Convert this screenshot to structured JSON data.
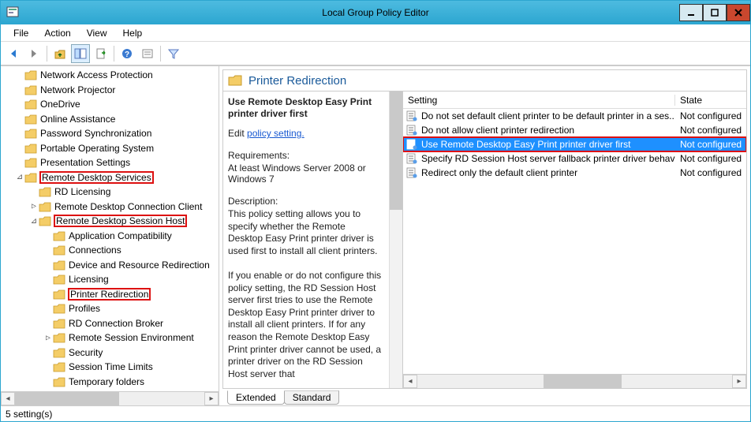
{
  "window": {
    "title": "Local Group Policy Editor"
  },
  "menu": {
    "file": "File",
    "action": "Action",
    "view": "View",
    "help": "Help"
  },
  "toolbar": {
    "back": "back",
    "forward": "forward",
    "up": "up-folder",
    "show_hide": "show-hide-tree",
    "export": "export-list",
    "help": "help",
    "props": "properties",
    "filter": "filter"
  },
  "tree": {
    "items": [
      {
        "indent": 1,
        "exp": "",
        "label": "Network Access Protection",
        "hl": false
      },
      {
        "indent": 1,
        "exp": "",
        "label": "Network Projector",
        "hl": false
      },
      {
        "indent": 1,
        "exp": "",
        "label": "OneDrive",
        "hl": false
      },
      {
        "indent": 1,
        "exp": "",
        "label": "Online Assistance",
        "hl": false
      },
      {
        "indent": 1,
        "exp": "",
        "label": "Password Synchronization",
        "hl": false
      },
      {
        "indent": 1,
        "exp": "",
        "label": "Portable Operating System",
        "hl": false
      },
      {
        "indent": 1,
        "exp": "",
        "label": "Presentation Settings",
        "hl": false
      },
      {
        "indent": 1,
        "exp": "⊿",
        "label": "Remote Desktop Services",
        "hl": true
      },
      {
        "indent": 2,
        "exp": "",
        "label": "RD Licensing",
        "hl": false
      },
      {
        "indent": 2,
        "exp": "▷",
        "label": "Remote Desktop Connection Client",
        "hl": false
      },
      {
        "indent": 2,
        "exp": "⊿",
        "label": "Remote Desktop Session Host",
        "hl": true
      },
      {
        "indent": 3,
        "exp": "",
        "label": "Application Compatibility",
        "hl": false
      },
      {
        "indent": 3,
        "exp": "",
        "label": "Connections",
        "hl": false
      },
      {
        "indent": 3,
        "exp": "",
        "label": "Device and Resource Redirection",
        "hl": false
      },
      {
        "indent": 3,
        "exp": "",
        "label": "Licensing",
        "hl": false
      },
      {
        "indent": 3,
        "exp": "",
        "label": "Printer Redirection",
        "hl": true
      },
      {
        "indent": 3,
        "exp": "",
        "label": "Profiles",
        "hl": false
      },
      {
        "indent": 3,
        "exp": "",
        "label": "RD Connection Broker",
        "hl": false
      },
      {
        "indent": 3,
        "exp": "▷",
        "label": "Remote Session Environment",
        "hl": false
      },
      {
        "indent": 3,
        "exp": "",
        "label": "Security",
        "hl": false
      },
      {
        "indent": 3,
        "exp": "",
        "label": "Session Time Limits",
        "hl": false
      },
      {
        "indent": 3,
        "exp": "",
        "label": "Temporary folders",
        "hl": false
      }
    ]
  },
  "details": {
    "header": "Printer Redirection",
    "policy_name": "Use Remote Desktop Easy Print printer driver first",
    "edit_label": "Edit",
    "edit_link": "policy setting.",
    "requirements_label": "Requirements:",
    "requirements_text": "At least Windows Server 2008 or Windows 7",
    "description_label": "Description:",
    "description_body": "This policy setting allows you to specify whether the Remote Desktop Easy Print printer driver is used first to install all client printers.\n\nIf you enable or do not configure this policy setting, the RD Session Host server first tries to use the Remote Desktop Easy Print printer driver to install all client printers. If for any reason the Remote Desktop Easy Print printer driver cannot be used, a printer driver on the RD Session Host server that"
  },
  "settings": {
    "col_setting": "Setting",
    "col_state": "State",
    "rows": [
      {
        "name": "Do not set default client printer to be default printer in a ses...",
        "state": "Not configured",
        "selected": false,
        "hl": false
      },
      {
        "name": "Do not allow client printer redirection",
        "state": "Not configured",
        "selected": false,
        "hl": false
      },
      {
        "name": "Use Remote Desktop Easy Print printer driver first",
        "state": "Not configured",
        "selected": true,
        "hl": true
      },
      {
        "name": "Specify RD Session Host server fallback printer driver behavior",
        "state": "Not configured",
        "selected": false,
        "hl": false
      },
      {
        "name": "Redirect only the default client printer",
        "state": "Not configured",
        "selected": false,
        "hl": false
      }
    ]
  },
  "tabs": {
    "extended": "Extended",
    "standard": "Standard"
  },
  "status": {
    "text": "5 setting(s)"
  }
}
